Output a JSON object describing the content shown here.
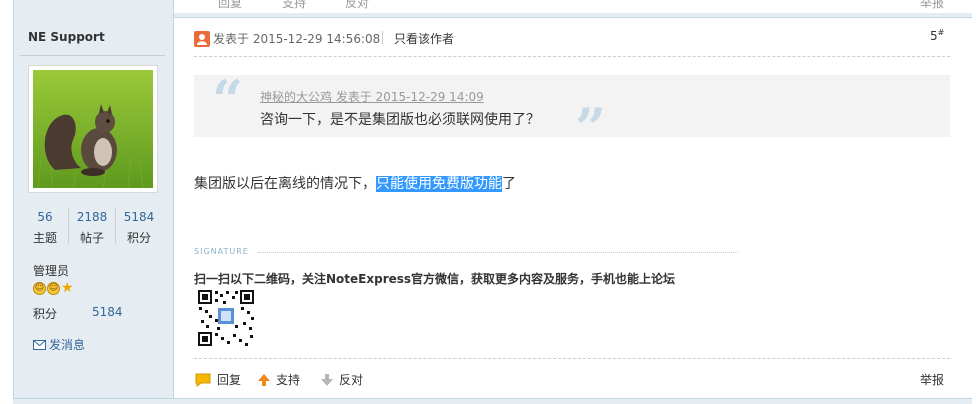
{
  "previous_post": {
    "reply_label": "回复",
    "support_label": "支持",
    "oppose_label": "反对",
    "report_label": "举报"
  },
  "author": {
    "name": "NE Support",
    "stats": [
      {
        "value": "56",
        "label": "主题"
      },
      {
        "value": "2188",
        "label": "帖子"
      },
      {
        "value": "5184",
        "label": "积分"
      }
    ],
    "rank": "管理员",
    "points_label": "积分",
    "points_value": "5184",
    "message_label": "发消息"
  },
  "post": {
    "posted_at": "发表于 2015-12-29 14:56:08",
    "only_author": "只看该作者",
    "floor": "5",
    "floor_suffix": "#",
    "quote": {
      "meta": "神秘的大公鸡 发表于 2015-12-29 14:09",
      "text": "咨询一下，是不是集团版也必须联网使用了？"
    },
    "reply": {
      "before": "集团版以后在离线的情况下，",
      "highlighted": "只能使用免费版功能",
      "after": "了"
    },
    "signature": {
      "label": "SIGNATURE",
      "text": "扫一扫以下二维码，关注NoteExpress官方微信，获取更多内容及服务，手机也能上论坛"
    }
  },
  "actions": {
    "reply": "回复",
    "support": "支持",
    "oppose": "反对",
    "report": "举报"
  }
}
